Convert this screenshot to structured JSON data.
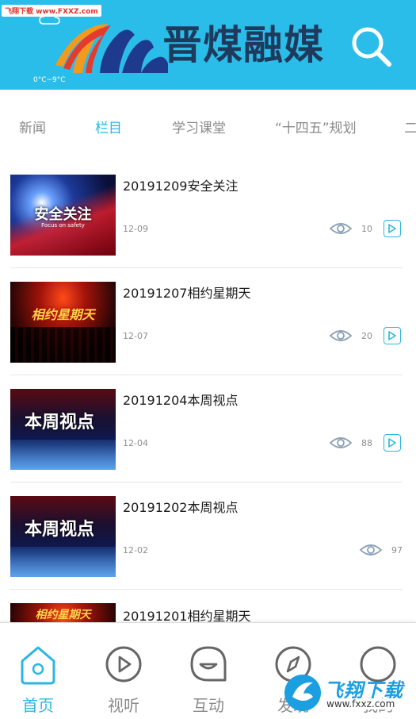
{
  "watermark_top": "飞翔下载 www.FXXZ.com",
  "header": {
    "temperature": "0°C~9°C",
    "logo_text": "晋煤融媒"
  },
  "tabs": [
    {
      "label": "新闻",
      "active": false
    },
    {
      "label": "栏目",
      "active": true
    },
    {
      "label": "学习课堂",
      "active": false
    },
    {
      "label": "“十四五”规划",
      "active": false
    },
    {
      "label": "二",
      "active": false
    }
  ],
  "items": [
    {
      "title": "20191209安全关注",
      "date": "12-09",
      "views": "10",
      "has_play": true,
      "thumb_text": "安全关注",
      "thumb_sub": "Focus on safety"
    },
    {
      "title": "20191207相约星期天",
      "date": "12-07",
      "views": "20",
      "has_play": true,
      "thumb_text": "相约星期天",
      "thumb_sub": ""
    },
    {
      "title": "20191204本周视点",
      "date": "12-04",
      "views": "88",
      "has_play": true,
      "thumb_text": "本周视点",
      "thumb_sub": ""
    },
    {
      "title": "20191202本周视点",
      "date": "12-02",
      "views": "97",
      "has_play": false,
      "thumb_text": "本周视点",
      "thumb_sub": ""
    },
    {
      "title": "20191201相约星期天",
      "date": "",
      "views": "",
      "has_play": false,
      "thumb_text": "相约星期天",
      "thumb_sub": ""
    }
  ],
  "nav": [
    {
      "label": "首页",
      "icon": "home-icon",
      "active": true
    },
    {
      "label": "视听",
      "icon": "play-circle-icon",
      "active": false
    },
    {
      "label": "互动",
      "icon": "chat-smile-icon",
      "active": false
    },
    {
      "label": "发现",
      "icon": "compass-icon",
      "active": false
    },
    {
      "label": "我的",
      "icon": "user-icon",
      "active": false
    }
  ],
  "watermark_badge": {
    "title": "飞翔下载",
    "url": "www.fxxz.com"
  },
  "colors": {
    "header_bg": "#2bbde9",
    "accent": "#2bb6e3",
    "logo_text": "#1e3a5c"
  }
}
